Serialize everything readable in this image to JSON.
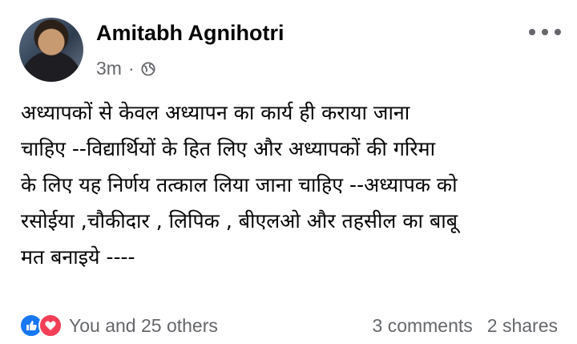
{
  "post": {
    "author": "Amitabh Agnihotri",
    "time": "3m",
    "separator": "·",
    "privacy_icon": "globe-icon",
    "more_icon": "more-options-icon",
    "text": "अध्यापकों से केवल अध्यापन का कार्य ही कराया जाना\nचाहिए --विद्यार्थियों के हित  लिए और अध्यापकों की गरिमा\nके लिए यह निर्णय तत्काल लिया जाना चाहिए --अध्यापक को\nरसोईया ,चौकीदार , लिपिक , बीएलओ और तहसील का बाबू\nमत बनाइये ----"
  },
  "footer": {
    "reaction_icons": [
      "like-icon",
      "love-icon"
    ],
    "reactions_text": "You and 25 others",
    "comments": "3 comments",
    "shares": "2 shares"
  },
  "colors": {
    "like": "#1877f2",
    "love": "#f33e58",
    "secondary_text": "#65676b"
  }
}
